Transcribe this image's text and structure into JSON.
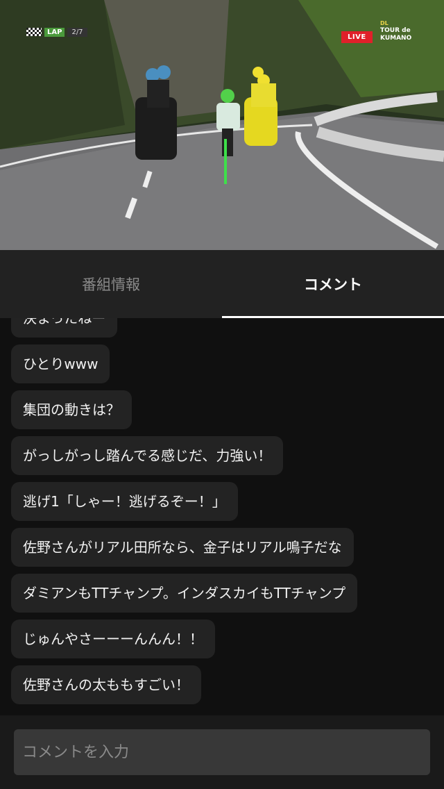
{
  "video": {
    "lap_label": "LAP",
    "lap_count": "2/7",
    "live_badge": "LIVE",
    "logo_top": "DL",
    "logo_line1": "TOUR de",
    "logo_line2": "KUMANO"
  },
  "tabs": {
    "info_label": "番組情報",
    "comment_label": "コメント"
  },
  "comments": [
    "決まったねー",
    "ひとりwww",
    "集団の動きは？",
    "がっしがっし踏んでる感じだ、力強い！",
    "逃げ1「しゃー！逃げるぞー！」",
    "佐野さんがリアル田所なら、金子はリアル鳴子だな",
    "ダミアンもTTチャンプ。インダスカイもTTチャンプ",
    "じゅんやさーーーんんん！！",
    "佐野さんの太ももすごい！"
  ],
  "input": {
    "placeholder": "コメントを入力"
  },
  "colors": {
    "accent_tab_indicator": "#ffffff",
    "live_red": "#e0202a",
    "lap_green": "#4b9a3c",
    "bubble_bg": "#232323"
  }
}
